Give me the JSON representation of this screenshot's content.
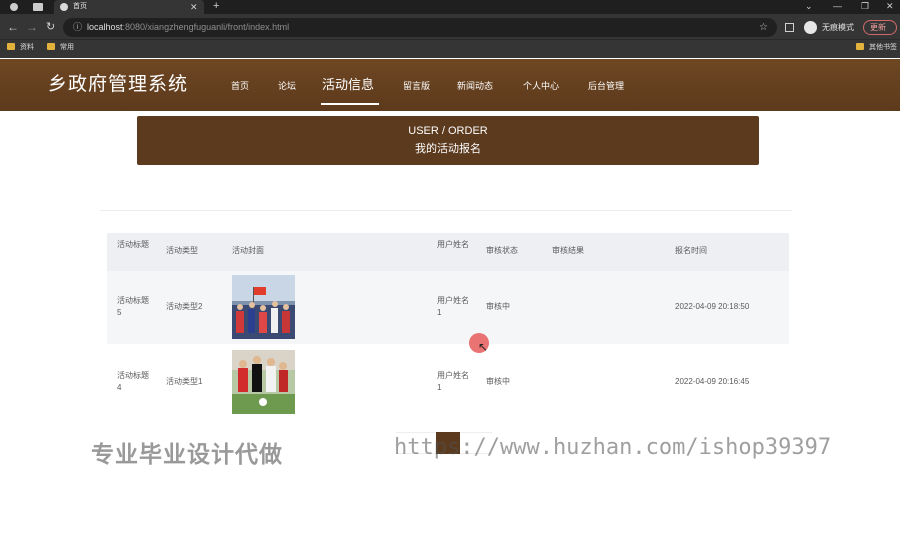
{
  "browser": {
    "tab_title": "首页",
    "url_host": "localhost",
    "url_rest": ":8080/xiangzhengfuguanli/front/index.html",
    "profile_label": "无痕模式",
    "update_label": "更新",
    "bookmarks": [
      "资料",
      "常用"
    ],
    "bookmark_right": "其他书签"
  },
  "site": {
    "title": "乡政府管理系统",
    "nav": [
      {
        "label": "首页"
      },
      {
        "label": "论坛"
      },
      {
        "label": "活动信息"
      },
      {
        "label": "留言版"
      },
      {
        "label": "新闻动态"
      },
      {
        "label": "个人中心"
      },
      {
        "label": "后台管理"
      }
    ],
    "active_nav": "活动信息"
  },
  "banner": {
    "en": "USER / ORDER",
    "cn": "我的活动报名"
  },
  "table": {
    "headers": {
      "title": "活动标题",
      "type": "活动类型",
      "cover": "活动封面",
      "user": "用户姓名",
      "status": "审核状态",
      "result": "审核结果",
      "time": "报名时间"
    },
    "rows": [
      {
        "title": "活动标题5",
        "type": "活动类型2",
        "user": "用户姓名1",
        "status": "审核中",
        "result": "",
        "time": "2022-04-09 20:18:50"
      },
      {
        "title": "活动标题4",
        "type": "活动类型1",
        "user": "用户姓名1",
        "status": "审核中",
        "result": "",
        "time": "2022-04-09 20:16:45"
      }
    ]
  },
  "watermark": {
    "cn": "专业毕业设计代做",
    "url": "https://www.huzhan.com/ishop39397"
  },
  "colors": {
    "brand": "#5c3a1e",
    "header": "#6e4723"
  }
}
